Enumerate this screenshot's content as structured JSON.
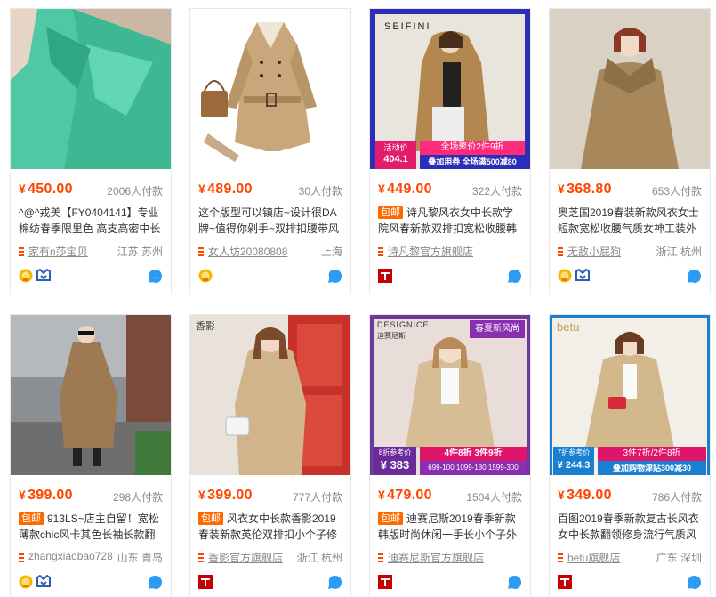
{
  "colors": {
    "price": "#ff4400",
    "accent": "#ff6a00",
    "muted": "#888888"
  },
  "products": [
    {
      "price": "450.00",
      "currency": "¥",
      "deals": "2006人付款",
      "tag": "",
      "title": "^@^戎美【FY0404141】专业棉纺春季限里色 高支高密中长",
      "shop": "家有n莎宝贝",
      "location": "江苏 苏州",
      "badges": [
        "gold-seller-icon",
        "guarantee-icon"
      ],
      "overlay": {}
    },
    {
      "price": "489.00",
      "currency": "¥",
      "deals": "30人付款",
      "tag": "",
      "title": "这个版型可以镇店~设计很DA牌~值得你剁手~双排扣腰带风",
      "shop": "女人坊20080808",
      "location": "上海",
      "badges": [
        "gold-seller-icon"
      ],
      "overlay": {}
    },
    {
      "price": "449.00",
      "currency": "¥",
      "deals": "322人付款",
      "tag": "包邮",
      "title": "诗凡黎风衣女中长款学院风春新款双排扣宽松收腰韩",
      "shop": "诗凡黎官方旗舰店",
      "location": "",
      "badges": [
        "tmall-icon"
      ],
      "overlay": {
        "brand": "SEIFINI",
        "promo1": "活动价",
        "promo_price": "404.1",
        "promo2": "全场聚价2件9折",
        "promo3": "叠加用券 全场满500减80"
      }
    },
    {
      "price": "368.80",
      "currency": "¥",
      "deals": "653人付款",
      "tag": "",
      "title": "奥芝国2019春装新款风衣女士短款宽松收腰气质女神工装外",
      "shop": "无敌小屁狗",
      "location": "浙江 杭州",
      "badges": [
        "gold-seller-icon",
        "guarantee-icon"
      ],
      "overlay": {}
    },
    {
      "price": "399.00",
      "currency": "¥",
      "deals": "298人付款",
      "tag": "包邮",
      "title": "913LS~店主自留！宽松薄款chic风卡其色长袖长款翻",
      "shop": "zhangxiaobao728",
      "location": "山东 青岛",
      "badges": [
        "gold-seller-icon",
        "guarantee-icon"
      ],
      "overlay": {}
    },
    {
      "price": "399.00",
      "currency": "¥",
      "deals": "777人付款",
      "tag": "包邮",
      "title": "风衣女中长款香影2019春装新款英伦双排扣小个子修",
      "shop": "香影官方旗舰店",
      "location": "浙江 杭州",
      "badges": [
        "tmall-icon"
      ],
      "overlay": {
        "brand": "香影"
      }
    },
    {
      "price": "479.00",
      "currency": "¥",
      "deals": "1504人付款",
      "tag": "包邮",
      "title": "迪赛尼斯2019春季新款韩版时尚休闲一手长小个子外",
      "shop": "迪赛尼斯官方旗舰店",
      "location": "",
      "badges": [
        "tmall-icon"
      ],
      "overlay": {
        "brand": "DESIGNICE",
        "brand_cn": "迪赛尼斯",
        "banner": "春夏新风尚",
        "promo1": "8折参考价",
        "promo_price": "383",
        "promo2": "4件8折 3件9折",
        "promo3": "699-100 1099-180 1599-300"
      }
    },
    {
      "price": "349.00",
      "currency": "¥",
      "deals": "786人付款",
      "tag": "",
      "title": "百图2019春季新款复古长风衣女中长款翻领修身流行气质风衣",
      "shop": "betu旗舰店",
      "location": "广东 深圳",
      "badges": [
        "tmall-icon"
      ],
      "overlay": {
        "brand": "betu",
        "promo1": "7折参考价",
        "promo_price": "244.3",
        "promo2": "3件7折/2件8折",
        "promo3": "叠加购物津贴300减30"
      }
    }
  ]
}
